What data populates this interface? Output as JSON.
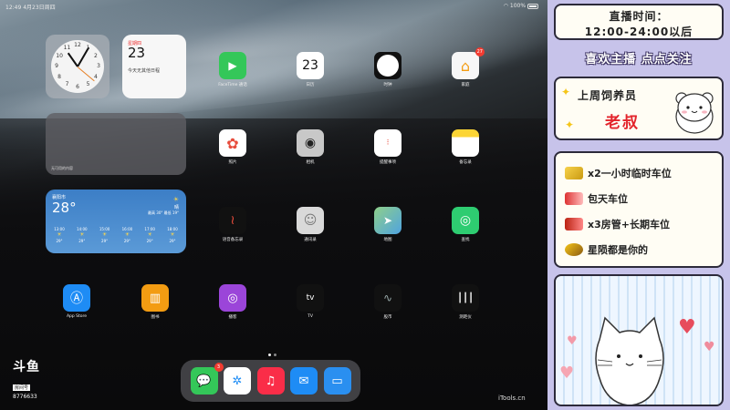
{
  "status_bar": {
    "time_date": "12:49  4月23日周四",
    "battery": "100%"
  },
  "widgets": {
    "clock_numbers": [
      "12",
      "1",
      "2",
      "3",
      "4",
      "5",
      "6",
      "7",
      "8",
      "9",
      "10",
      "11"
    ],
    "calendar": {
      "weekday": "星期四",
      "day": "23",
      "no_events": "今天无其他日程"
    },
    "empty_widget_label": "无可用的内容",
    "weather": {
      "city": "襄阳市",
      "temp": "28°",
      "condition": "晴",
      "hilo": "最高 30° 最低 19°",
      "hours": [
        {
          "t": "13:00",
          "v": "29°"
        },
        {
          "t": "14:00",
          "v": "29°"
        },
        {
          "t": "15:00",
          "v": "29°"
        },
        {
          "t": "16:00",
          "v": "29°"
        },
        {
          "t": "17:00",
          "v": "29°"
        },
        {
          "t": "18:00",
          "v": "29°"
        }
      ]
    }
  },
  "apps": {
    "facetime": "FaceTime 通话",
    "calendar": "日历",
    "calendar_day": "23",
    "clock": "时钟",
    "home": "家庭",
    "home_badge": "27",
    "photos": "照片",
    "camera": "相机",
    "reminders": "提醒事项",
    "notes": "备忘录",
    "voice_memos": "语音备忘录",
    "contacts": "通讯录",
    "maps": "地图",
    "find_my": "查找",
    "app_store": "App Store",
    "books": "图书",
    "podcasts": "播客",
    "tv": "TV",
    "stocks": "股市",
    "measure": "测距仪"
  },
  "dock": {
    "messages_badge": "3"
  },
  "overlay": {
    "douyu_logo": "斗鱼",
    "douyu_room": "房间号",
    "douyu_id": "8776633",
    "itools": "iTools.cn"
  },
  "panel": {
    "time_title": "直播时间：",
    "time_range": "12:00-24:00以后",
    "slogan": "喜欢主播 点点关注",
    "nick_title": "上周饲养员",
    "nick_name": "老叔",
    "gifts": [
      {
        "text": "x2一小时临时车位"
      },
      {
        "text": "包天车位"
      },
      {
        "text": "x3房管+长期车位"
      },
      {
        "text": "星陨都是你的"
      }
    ]
  },
  "colors": {
    "panel_bg": "#c7c3ea",
    "nick_red": "#e3242b",
    "badge_red": "#f23b30"
  }
}
